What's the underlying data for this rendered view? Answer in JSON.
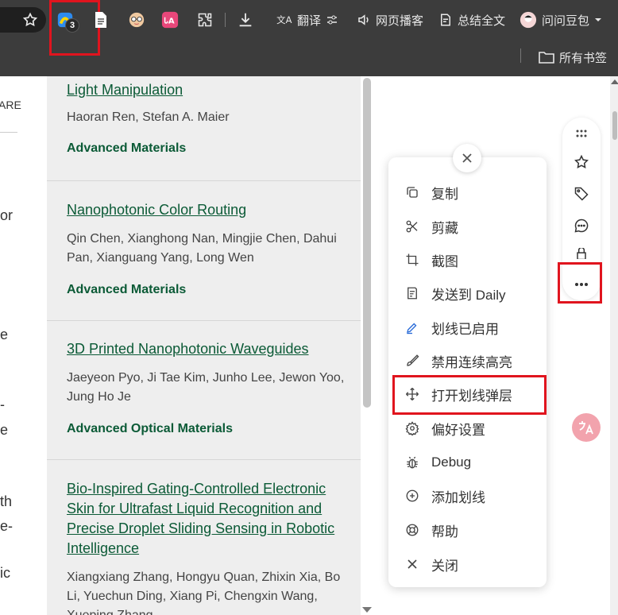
{
  "toolbar": {
    "extension_badge": "3",
    "translate_label": "翻译",
    "read_aloud_label": "网页播客",
    "summarize_label": "总结全文",
    "profile_label": "问问豆包",
    "bookmarks_label": "所有书签"
  },
  "left_strip": {
    "fragments": [
      "ARE",
      "or",
      "e",
      "-",
      "e",
      "th",
      "e-",
      "ic"
    ]
  },
  "results": [
    {
      "title": "Light Manipulation",
      "authors": "Haoran Ren, Stefan A. Maier",
      "journal": "Advanced Materials"
    },
    {
      "title": "Nanophotonic Color Routing",
      "authors": "Qin Chen, Xianghong Nan, Mingjie Chen, Dahui Pan, Xianguang Yang, Long Wen",
      "journal": "Advanced Materials"
    },
    {
      "title": "3D Printed Nanophotonic Waveguides",
      "authors": "Jaeyeon Pyo, Ji Tae Kim, Junho Lee, Jewon Yoo, Jung Ho Je",
      "journal": "Advanced Optical Materials"
    },
    {
      "title": "Bio‐Inspired Gating‐Controlled Electronic Skin for Ultrafast Liquid Recognition and Precise Droplet Sliding Sensing in Robotic Intelligence",
      "authors": "Xiangxiang Zhang, Hongyu Quan, Zhixin Xia, Bo Li, Yuechun Ding, Xiang Pi, Chengxin Wang, Xueping Zhang",
      "journal": ""
    }
  ],
  "menu": {
    "items": [
      {
        "label": "复制",
        "icon": "copy-icon"
      },
      {
        "label": "剪藏",
        "icon": "scissors-icon"
      },
      {
        "label": "截图",
        "icon": "crop-icon"
      },
      {
        "label": "发送到 Daily",
        "icon": "send-daily-icon"
      },
      {
        "label": "划线已启用",
        "icon": "highlighter-icon"
      },
      {
        "label": "禁用连续高亮",
        "icon": "brush-icon"
      },
      {
        "label": "打开划线弹层",
        "icon": "move-icon"
      },
      {
        "label": "偏好设置",
        "icon": "gear-icon"
      },
      {
        "label": "Debug",
        "icon": "bug-icon"
      },
      {
        "label": "添加划线",
        "icon": "plus-circle-icon"
      },
      {
        "label": "帮助",
        "icon": "help-lifebuoy-icon"
      },
      {
        "label": "关闭",
        "icon": "close-icon"
      }
    ]
  },
  "float_button": {
    "label": "Ꭶ"
  },
  "colors": {
    "toolbar_bg": "#3c3c3c",
    "link_green": "#0b5a36",
    "highlight_red": "#e0141e",
    "results_bg": "#eeeeee"
  }
}
